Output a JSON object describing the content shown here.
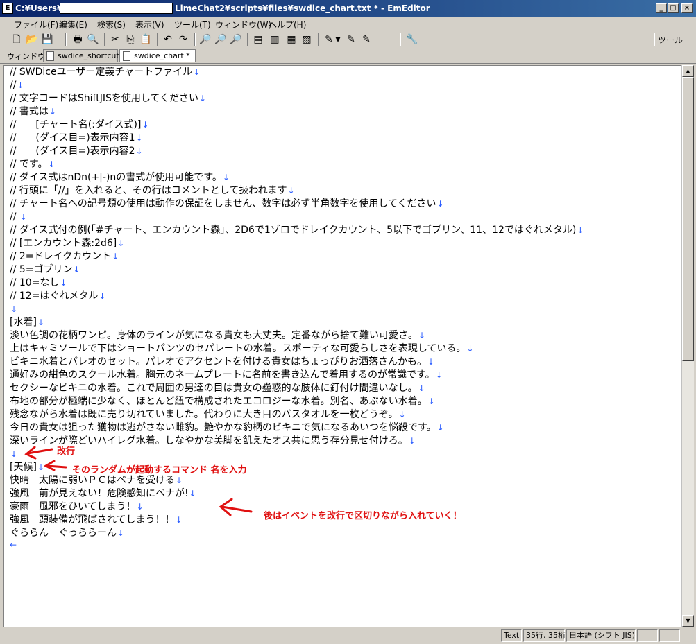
{
  "window": {
    "icon_text": "E",
    "title_left": "C:¥Users¥",
    "title_right": "LimeChat2¥scripts¥files¥swdice_chart.txt * - EmEditor",
    "minimize": "_",
    "maximize": "□",
    "close": "×"
  },
  "menu": [
    "ファイル(F)",
    "編集(E)",
    "検索(S)",
    "表示(V)",
    "ツール(T)",
    "ウィンドウ(W)",
    "ヘルプ(H)"
  ],
  "toolbar": {
    "right_label": "ツール",
    "icons": [
      "new-file-icon",
      "open-folder-icon",
      "save-icon",
      "print-icon",
      "print-preview-icon",
      "cut-icon",
      "copy-icon",
      "paste-icon",
      "undo-icon",
      "redo-icon",
      "find-icon",
      "find-next-icon",
      "find-prev-icon",
      "view-icon-1",
      "view-icon-2",
      "view-icon-3",
      "view-icon-4",
      "dropdown-icon",
      "macro-icon-1",
      "macro-icon-2",
      "macro-icon-3",
      "plugin-icon"
    ],
    "glyphs": [
      "🗋",
      "📂",
      "💾",
      "🖶",
      "🔍",
      "✂",
      "⎘",
      "📋",
      "↶",
      "↷",
      "🔎",
      "🔎",
      "🔎",
      "▤",
      "▥",
      "▦",
      "▧",
      "▾",
      "✎",
      "✎",
      "✎",
      "🔧"
    ]
  },
  "tabs": {
    "window_label": "ウィンドウ",
    "items": [
      {
        "label": "swdice_shortcut"
      },
      {
        "label": "swdice_chart *"
      }
    ]
  },
  "editor": {
    "eol_symbol": "↓",
    "eof_symbol": "←",
    "lines": [
      "// SWDiceユーザー定義チャートファイル",
      "//",
      "// 文字コードはShiftJISを使用してください",
      "// 書式は",
      "//　　[チャート名(:ダイス式)]",
      "//　　(ダイス目=)表示内容1",
      "//　　(ダイス目=)表示内容2",
      "// です。",
      "// ダイス式はnDn(+|-)nの書式が使用可能です。",
      "// 行頭に「//」を入れると、その行はコメントとして扱われます",
      "// チャート名への記号類の使用は動作の保証をしません、数字は必ず半角数字を使用してください",
      "// ",
      "// ダイス式付の例(「#チャート、エンカウント森」、2D6で1ゾロでドレイクカウント、5以下でゴブリン、11、12ではぐれメタル)",
      "// [エンカウント森:2d6]",
      "// 2=ドレイクカウント",
      "// 5=ゴブリン",
      "// 10=なし",
      "// 12=はぐれメタル",
      "",
      "[水着]",
      "淡い色調の花柄ワンピ。身体のラインが気になる貴女も大丈夫。定番ながら捨て難い可愛さ。",
      "上はキャミソールで下はショートパンツのセパレートの水着。スポーティな可愛らしさを表現している。",
      "ビキニ水着とパレオのセット。パレオでアクセントを付ける貴女はちょっぴりお洒落さんかも。",
      "通好みの紺色のスクール水着。胸元のネームプレートに名前を書き込んで着用するのが常識です。",
      "セクシーなビキニの水着。これで周囲の男達の目は貴女の蠱惑的な肢体に釘付け間違いなし。",
      "布地の部分が極端に少なく、ほとんど紐で構成されたエコロジーな水着。別名、あぶない水着。",
      "残念ながら水着は既に売り切れていました。代わりに大き目のバスタオルを一枚どうぞ。",
      "今日の貴女は狙った獲物は逃がさない雌豹。艶やかな豹柄のビキニで気になるあいつを悩殺です。",
      "深いラインが際どいハイレグ水着。しなやかな美脚を飢えたオス共に思う存分見せ付けろ。",
      "",
      "[天候]",
      "快晴　太陽に弱いＰＣはペナを受ける",
      "強風　前が見えない！危険感知にペナが!",
      "豪雨　風邪をひいてしまう！",
      "強風　頭装備が飛ばされてしまう！！",
      "ぐららん　ぐっららーん"
    ]
  },
  "annotations": {
    "newline": "改行",
    "command": "そのランダムが起動するコマンド 名を入力",
    "events": "後はイベントを改行で区切りながら入れていく！"
  },
  "status": {
    "mode": "Text",
    "position": "35行, 35桁",
    "encoding": "日本語 (シフト JIS)"
  }
}
